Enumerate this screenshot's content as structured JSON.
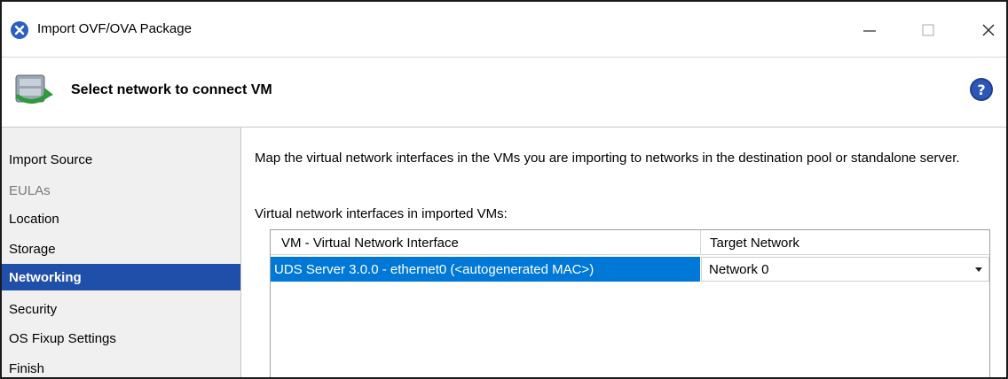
{
  "window": {
    "title": "Import OVF/OVA Package",
    "app_icon": "xencenter-icon",
    "controls": [
      "minimize-icon",
      "maximize-icon",
      "close-icon"
    ]
  },
  "header": {
    "title": "Select network to connect VM",
    "icon": "import-wizard-icon",
    "help_icon": "help-icon"
  },
  "sidebar": {
    "items": [
      {
        "label": "Import Source",
        "state": "normal"
      },
      {
        "label": "EULAs",
        "state": "disabled"
      },
      {
        "label": "Location",
        "state": "normal"
      },
      {
        "label": "Storage",
        "state": "normal"
      },
      {
        "label": "Networking",
        "state": "active"
      },
      {
        "label": "Security",
        "state": "normal"
      },
      {
        "label": "OS Fixup Settings",
        "state": "normal"
      },
      {
        "label": "Finish",
        "state": "normal"
      }
    ]
  },
  "main": {
    "description": "Map the virtual network interfaces in the VMs you are importing to networks in the destination pool or standalone server.",
    "list_label": "Virtual network interfaces in imported VMs:",
    "table": {
      "columns": [
        "VM - Virtual Network Interface",
        "Target Network"
      ],
      "rows": [
        {
          "vif": "UDS Server 3.0.0 - ethernet0 (<autogenerated MAC>)",
          "network": "Network 0",
          "selected": true
        }
      ]
    }
  },
  "colors": {
    "selection": "#0078d7",
    "active_nav": "#1f4fa8",
    "sidebar_bg": "#f0f0f0"
  }
}
